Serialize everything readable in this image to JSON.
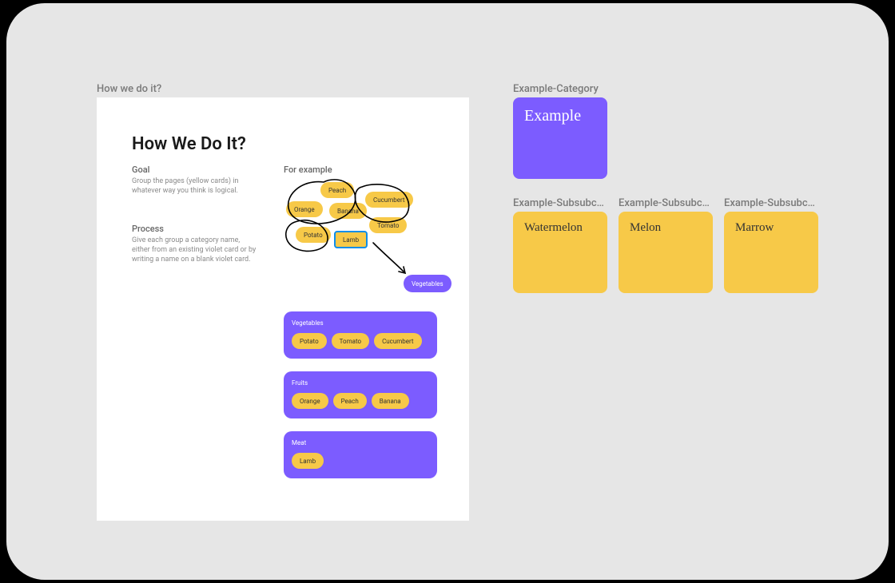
{
  "left": {
    "frame_label": "How we do it?",
    "title": "How We Do It?",
    "goal_heading": "Goal",
    "goal_text": "Group the pages (yellow cards) in whatever way you think is logical.",
    "process_heading": "Process",
    "process_text": "Give each group a category name, either from an existing violet card or by writing a name on a blank violet card.",
    "example_heading": "For example",
    "scatter": {
      "peach": "Peach",
      "orange": "Orange",
      "banana": "Banana",
      "cucumbert": "Cucumbert",
      "tomato": "Tomato",
      "potato": "Potato",
      "lamb": "Lamb"
    },
    "violet_tag": "Vegetables",
    "groups": [
      {
        "name": "Vegetables",
        "items": [
          "Potato",
          "Tomato",
          "Cucumbert"
        ]
      },
      {
        "name": "Fruits",
        "items": [
          "Orange",
          "Peach",
          "Banana"
        ]
      },
      {
        "name": "Meat",
        "items": [
          "Lamb"
        ]
      }
    ]
  },
  "right": {
    "category_label": "Example-Category",
    "category_card": "Example",
    "sub_labels": [
      "Example-Subsubcategory",
      "Example-Subsubcategory",
      "Example-Subsubcategory"
    ],
    "sub_cards": [
      "Watermelon",
      "Melon",
      "Marrow"
    ]
  },
  "colors": {
    "violet": "#7c5cff",
    "yellow": "#f7c948",
    "bg": "#e6e6e6"
  }
}
